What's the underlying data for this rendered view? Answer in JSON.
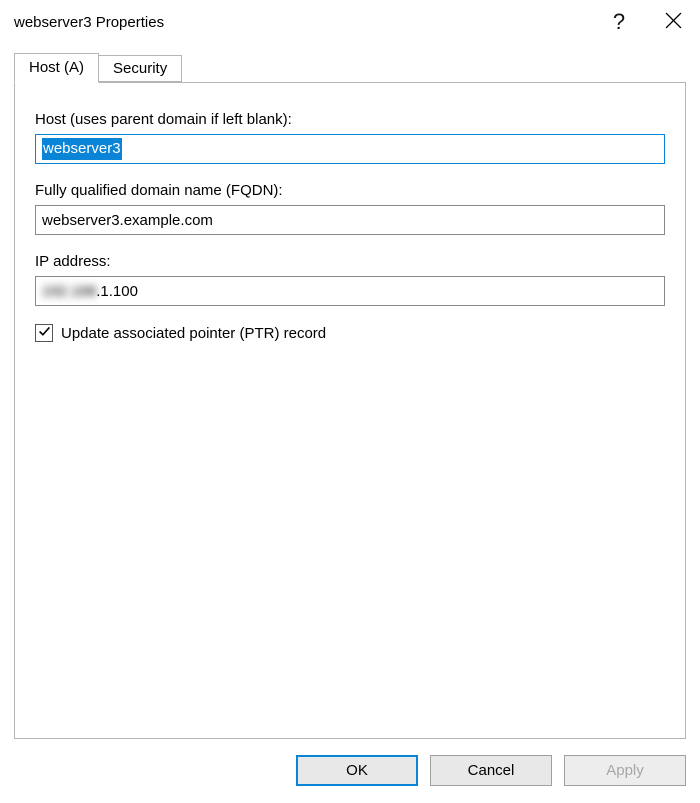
{
  "titlebar": {
    "title": "webserver3 Properties",
    "help_glyph": "?"
  },
  "tabs": [
    {
      "label": "Host (A)"
    },
    {
      "label": "Security"
    }
  ],
  "fields": {
    "host": {
      "label": "Host (uses parent domain if left blank):",
      "value": "webserver3"
    },
    "fqdn": {
      "label": "Fully qualified domain name (FQDN):",
      "value": "webserver3.example.com"
    },
    "ip": {
      "label": "IP address:",
      "value_masked_prefix": "192.168",
      "value_suffix": ".1.100"
    },
    "ptr": {
      "label": "Update associated pointer (PTR) record",
      "checked": true
    }
  },
  "buttons": {
    "ok": "OK",
    "cancel": "Cancel",
    "apply": "Apply"
  }
}
